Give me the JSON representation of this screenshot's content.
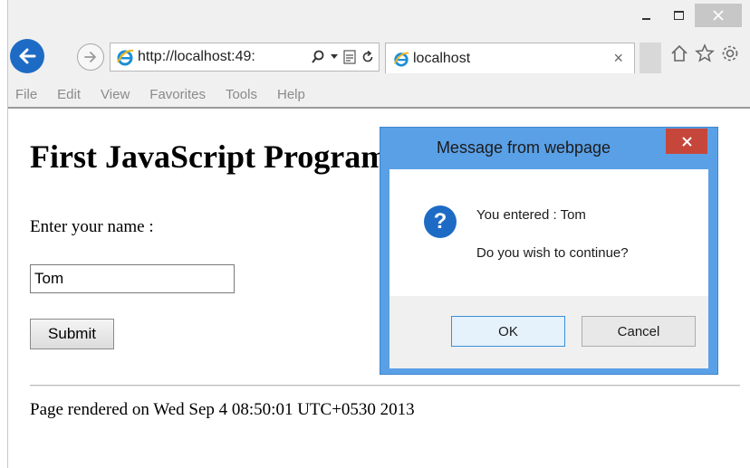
{
  "browser": {
    "address_url": "http://localhost:49:",
    "tab_title": "localhost",
    "tab_close": "×",
    "menu": [
      "File",
      "Edit",
      "View",
      "Favorites",
      "Tools",
      "Help"
    ],
    "icons": {
      "back": "back-arrow-icon",
      "forward": "forward-arrow-icon",
      "search": "search-icon",
      "compat": "compatibility-view-icon",
      "refresh": "refresh-icon",
      "home": "home-icon",
      "favorites": "star-icon",
      "settings": "gear-icon"
    },
    "accent": "#1e6bc5"
  },
  "page": {
    "title": "First JavaScript Program",
    "name_label": "Enter your name :",
    "name_value": "Tom",
    "submit_label": "Submit",
    "rendered_on": "Page rendered on Wed Sep 4 08:50:01 UTC+0530 2013"
  },
  "dialog": {
    "title": "Message from webpage",
    "close": "×",
    "icon": "question-icon",
    "line1": "You entered : Tom",
    "line2": "Do you wish to continue?",
    "ok_label": "OK",
    "cancel_label": "Cancel",
    "frame_color": "#5aa0e6"
  }
}
